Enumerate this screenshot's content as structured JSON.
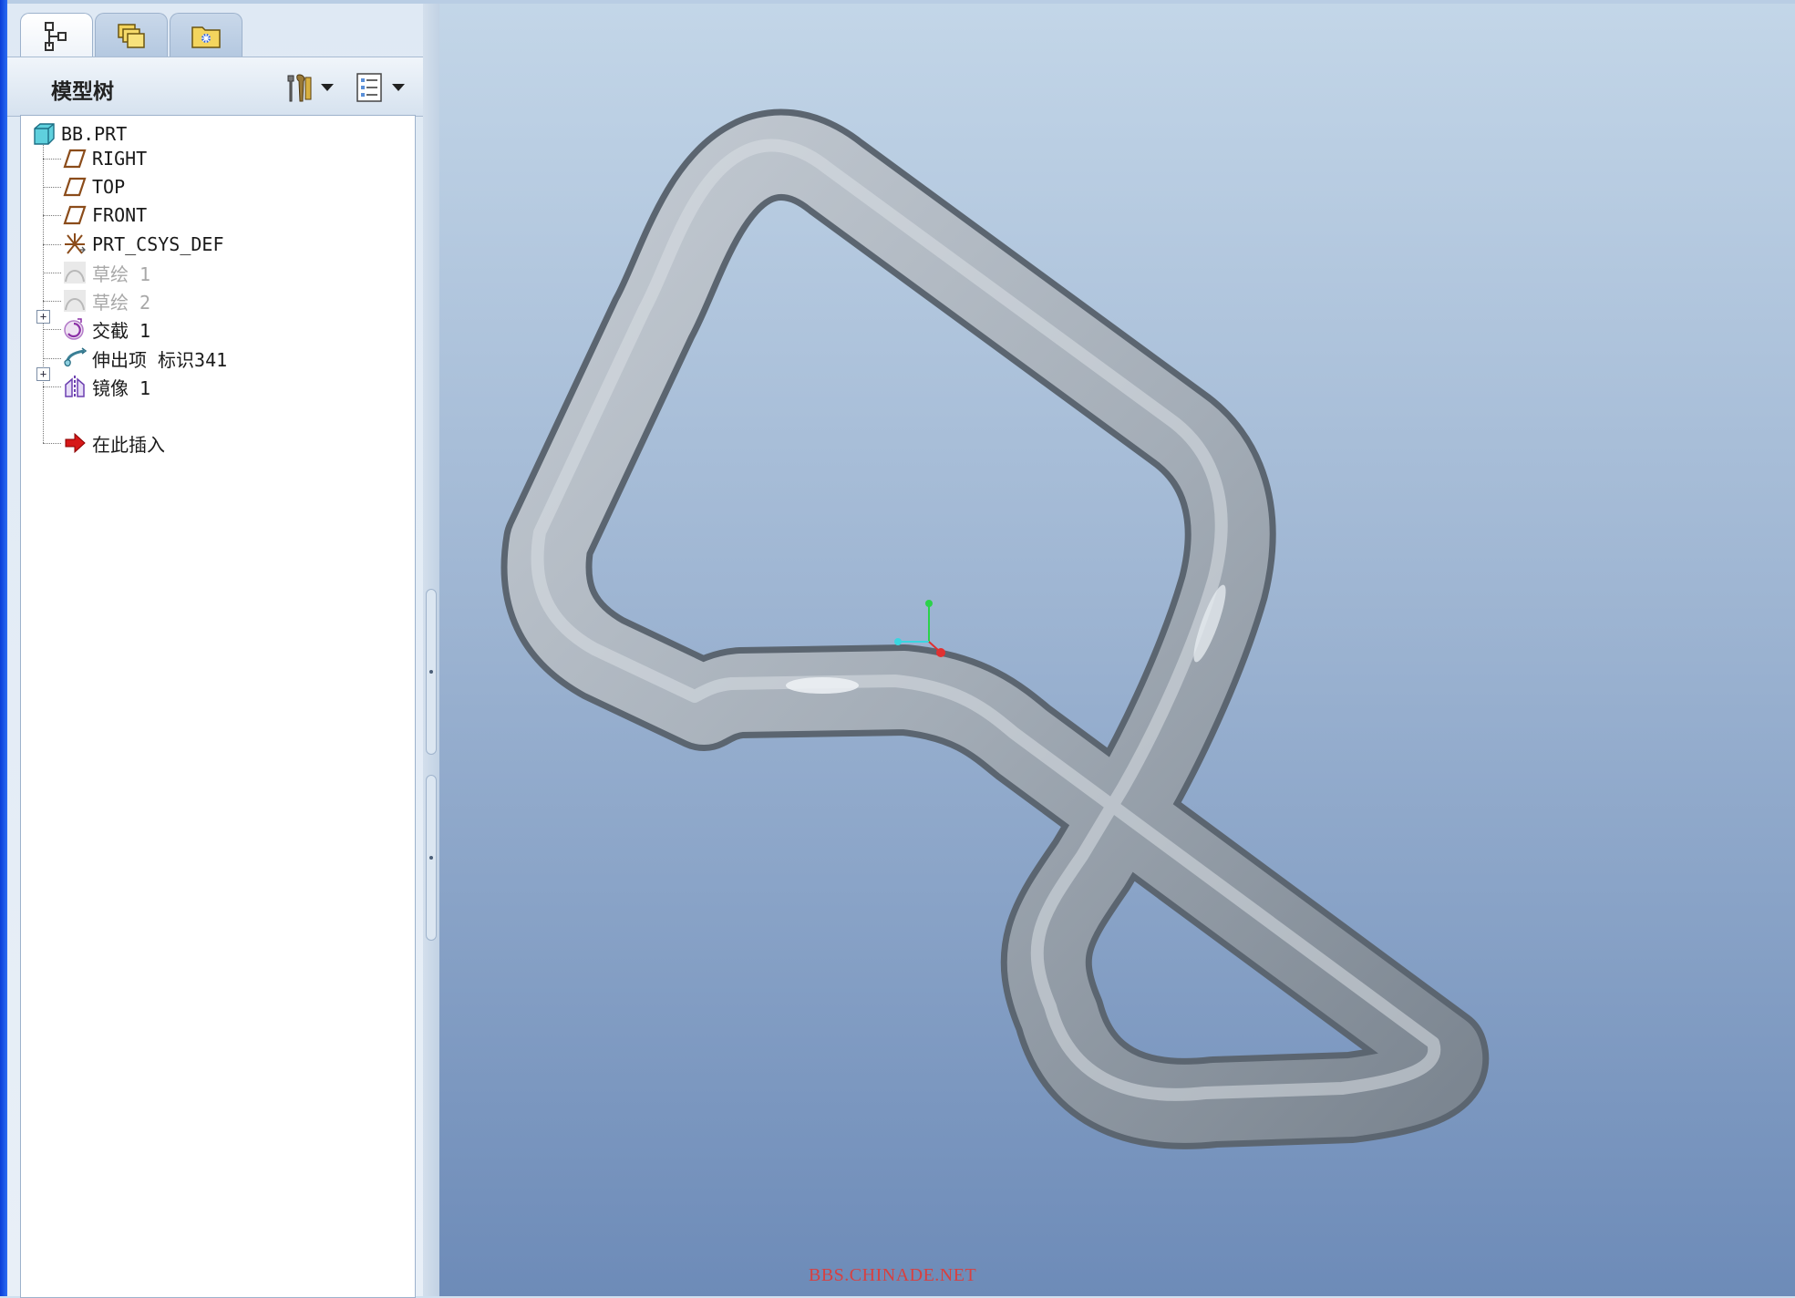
{
  "panel": {
    "tabs": [
      {
        "name": "model-tree-tab",
        "icon": "model-tree-icon",
        "active": true
      },
      {
        "name": "folder-browser-tab",
        "icon": "folders-icon",
        "active": false
      },
      {
        "name": "favorites-tab",
        "icon": "favorites-folder-icon",
        "active": false
      }
    ],
    "title": "模型树",
    "settings_icon": "tools-icon",
    "show_icon": "show-list-icon"
  },
  "tree": {
    "items": [
      {
        "label": "BB.PRT",
        "icon": "part-icon",
        "dim": false,
        "expandable": false
      },
      {
        "label": "RIGHT",
        "icon": "datum-plane-icon",
        "dim": false,
        "expandable": false
      },
      {
        "label": "TOP",
        "icon": "datum-plane-icon",
        "dim": false,
        "expandable": false
      },
      {
        "label": "FRONT",
        "icon": "datum-plane-icon",
        "dim": false,
        "expandable": false
      },
      {
        "label": "PRT_CSYS_DEF",
        "icon": "coordinate-system-icon",
        "dim": false,
        "expandable": false
      },
      {
        "label": "草绘 1",
        "icon": "sketch-icon",
        "dim": true,
        "expandable": false
      },
      {
        "label": "草绘 2",
        "icon": "sketch-icon",
        "dim": true,
        "expandable": false
      },
      {
        "label": "交截 1",
        "icon": "intersect-icon",
        "dim": false,
        "expandable": true
      },
      {
        "label": "伸出项 标识341",
        "icon": "sweep-protrusion-icon",
        "dim": false,
        "expandable": false
      },
      {
        "label": "镜像 1",
        "icon": "mirror-icon",
        "dim": false,
        "expandable": true
      },
      {
        "label": "在此插入",
        "icon": "insert-here-arrow-icon",
        "dim": false,
        "expandable": false
      }
    ]
  },
  "viewport": {
    "background_top": "#c3d6e8",
    "background_bottom": "#6d8bb8",
    "model_color": "#9aa3ad",
    "csys_axes": {
      "x": "#3ad6e0",
      "y": "#2bd24a",
      "z": "#e03030"
    },
    "watermark": "BBS.CHINADE.NET"
  }
}
